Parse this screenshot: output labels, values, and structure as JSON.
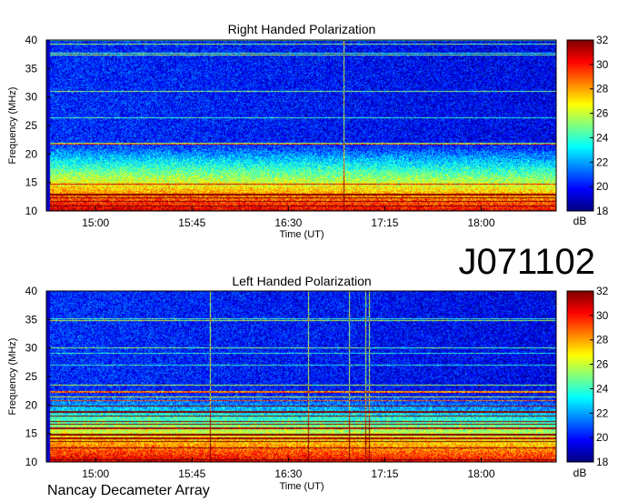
{
  "figure_id": "J071102",
  "footer": "Nancay Decameter Array",
  "chart_data": [
    {
      "type": "heatmap",
      "title": "Right Handed Polarization",
      "xlabel": "Time (UT)",
      "ylabel": "Frequency (MHz)",
      "x_ticks": [
        "15:00",
        "15:45",
        "16:30",
        "17:15",
        "18:00"
      ],
      "y_ticks": [
        10,
        15,
        20,
        25,
        30,
        35,
        40
      ],
      "xlim": [
        "14:37",
        "18:35"
      ],
      "ylim": [
        10,
        40
      ],
      "colorbar": {
        "label": "dB",
        "ticks": [
          18,
          20,
          22,
          24,
          26,
          28,
          30,
          32
        ],
        "range": [
          18,
          32
        ],
        "colormap": "jet"
      }
    },
    {
      "type": "heatmap",
      "title": "Left Handed Polarization",
      "xlabel": "Time (UT)",
      "ylabel": "Frequency (MHz)",
      "x_ticks": [
        "15:00",
        "15:45",
        "16:30",
        "17:15",
        "18:00"
      ],
      "y_ticks": [
        10,
        15,
        20,
        25,
        30,
        35,
        40
      ],
      "xlim": [
        "14:37",
        "18:35"
      ],
      "ylim": [
        10,
        40
      ],
      "colorbar": {
        "label": "dB",
        "ticks": [
          18,
          20,
          22,
          24,
          26,
          28,
          30,
          32
        ],
        "range": [
          18,
          32
        ],
        "colormap": "jet"
      }
    }
  ]
}
